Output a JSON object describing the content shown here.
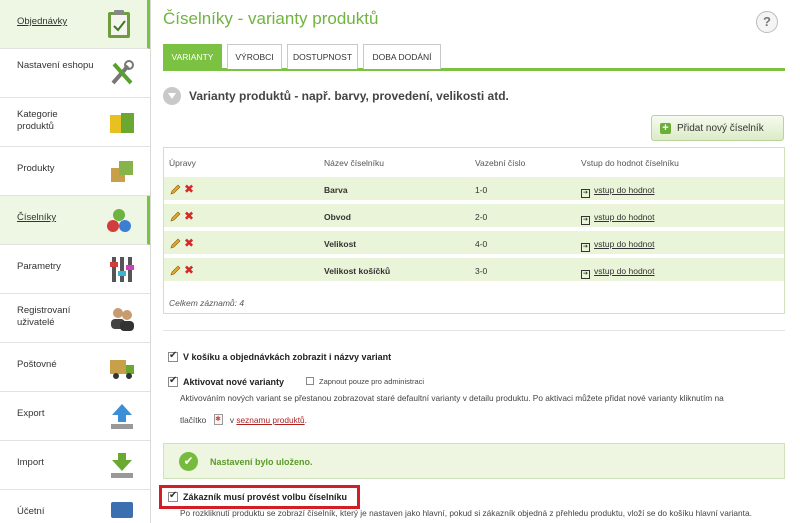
{
  "sidebar": {
    "items": [
      {
        "label": "Objednávky",
        "active": true,
        "icon": "clipboard-icon"
      },
      {
        "label": "Nastavení eshopu",
        "icon": "tools-icon"
      },
      {
        "label": "Kategorie produktů",
        "icon": "folders-icon"
      },
      {
        "label": "Produkty",
        "icon": "boxes-icon"
      },
      {
        "label": "Číselníky",
        "active": true,
        "icon": "numbered-balls-icon"
      },
      {
        "label": "Parametry",
        "icon": "sliders-icon"
      },
      {
        "label": "Registrovaní uživatelé",
        "icon": "users-icon"
      },
      {
        "label": "Poštovné",
        "icon": "truck-icon"
      },
      {
        "label": "Export",
        "icon": "upload-arrow-icon"
      },
      {
        "label": "Import",
        "icon": "download-arrow-icon"
      },
      {
        "label": "Účetní",
        "icon": "monitor-icon"
      }
    ]
  },
  "page": {
    "title": "Číselníky - varianty produktů",
    "help": "?"
  },
  "tabs": [
    "VARIANTY",
    "VÝROBCI",
    "DOSTUPNOST",
    "DOBA DODÁNÍ"
  ],
  "section_title": "Varianty produktů - např. barvy, provedení, velikosti atd.",
  "add_button": "Přidat nový číselník",
  "table": {
    "headers": [
      "Úpravy",
      "Název číselníku",
      "Vazební číslo",
      "Vstup do hodnot číselníku"
    ],
    "rows": [
      {
        "name": "Barva",
        "code": "1-0",
        "link": "vstup do hodnot"
      },
      {
        "name": "Obvod",
        "code": "2-0",
        "link": "vstup do hodnot"
      },
      {
        "name": "Velikost",
        "code": "4-0",
        "link": "vstup do hodnot"
      },
      {
        "name": "Velikost košíčků",
        "code": "3-0",
        "link": "vstup do hodnot"
      }
    ],
    "total": "Celkem záznamů: 4"
  },
  "options": {
    "show_names": "V košíku a objednávkách zobrazit i názvy variant",
    "activate_new": "Aktivovat nové varianty",
    "admin_only": "Zapnout pouze pro administraci",
    "desc_line1": "Aktivováním nových variant se přestanou zobrazovat staré defaultní varianty v detailu produktu. Po aktivaci můžete přidat nové varianty kliknutím na",
    "desc_line2_a": "tlačítko",
    "desc_line2_b": "v",
    "desc_link": "seznamu produktů",
    "desc_line2_c": "."
  },
  "saved_message": "Nastavení bylo uloženo.",
  "customer_option": {
    "label": "Zákazník musí provést volbu číselníku",
    "desc": "Po rozkliknutí produktu se zobrazí číselník, který je nastaven jako hlavní, pokud si zákazník objedná z přehledu produktu, vloží se do košíku hlavní varianta."
  }
}
